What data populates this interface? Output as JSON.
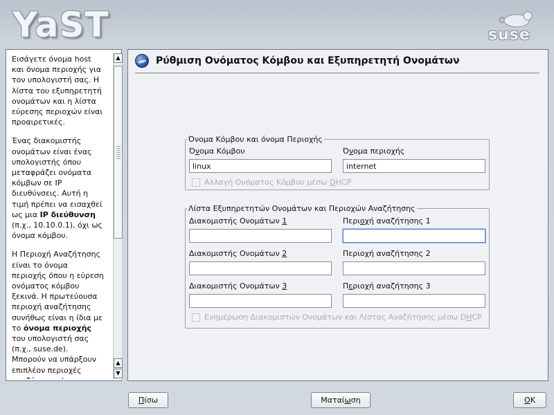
{
  "branding": {
    "app_logo": "YaST",
    "vendor_logo": "suse"
  },
  "help": {
    "paragraphs": [
      [
        "Εισάγετε όνομα host και όνομα περιοχής για τον υπολογιστή σας. Η λίστα του εξυπηρετητή ονομάτων και η λίστα εύρεσης περιοχών είναι προαιρετικές."
      ],
      [
        "Ένας διακομιστής ονομάτων είναι ένας υπολογιστής όπου μεταφράζει ονόματα κόμβων σε IP διευθύνσεις. Αυτή η τιμή πρέπει να εισαχθεί ως μια ",
        "IP διεύθυνση",
        " (π.χ., 10.10.0.1), όχι ως όνομα κόμβου."
      ],
      [
        "Η Περιοχή Αναζήτησης είναι το όνομα περιοχής όπου η εύρεση ονόματος κόμβου ξεκινά. Η πρωτεύουσα περιοχή αναζήτησης συνήθως είναι η ίδια με το ",
        "όνομα περιοχής",
        " του υπολογιστή σας (π.χ., suse.de). Μπορούν να υπάρξουν επιπλέον περιοχές αναζήτησης (π.χ., suse.com)."
      ]
    ]
  },
  "page": {
    "title": "Ρύθμιση Ονόματος Κόμβου και Εξυπηρετητή Ονομάτων"
  },
  "hostname_group": {
    "legend": "Όνομα Κόμβου και όνομα Περιοχής",
    "hostname_label": "Όνομα Κόμβου",
    "hostname_value": "linux",
    "domain_label": "Όνομα περιοχής",
    "domain_value": "internet",
    "dhcp_label": "Αλλαγή Ονόματος Κόμβου μέσω DHCP",
    "dhcp_checked": false
  },
  "dns_group": {
    "legend": "Λίστα Εξυπηρετητών Ονομάτων και Περιοχών Αναζήτησης",
    "ns1_label": "Διακομιστής Ονομάτων 1",
    "ns1_value": "",
    "ns2_label": "Διακομιστής Ονομάτων 2",
    "ns2_value": "",
    "ns3_label": "Διακομιστής Ονομάτων 3",
    "ns3_value": "",
    "search1_label": "Περιοχή αναζήτησης 1",
    "search1_value": "",
    "search2_label": "Περιοχή αναζήτησης 2",
    "search2_value": "",
    "search3_label": "Περιοχή αναζήτησης 3",
    "search3_value": "",
    "dhcp_label": "Ενημέρωση Διακομιστών Ονομάτων και Λίστας Αναζήτησης μέσω DHCP",
    "dhcp_checked": false
  },
  "buttons": {
    "back": "Πίσω",
    "abort": "Ματαίωση",
    "ok": "OK"
  }
}
